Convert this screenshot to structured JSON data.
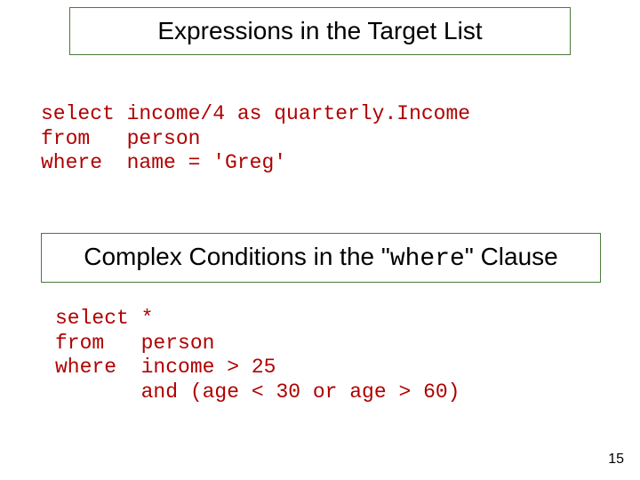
{
  "heading1": "Expressions in the Target List",
  "heading2_pre": "Complex Conditions in the \"",
  "heading2_mono": "where",
  "heading2_post": "\" Clause",
  "code1": "select income/4 as quarterly.Income\nfrom   person\nwhere  name = 'Greg'",
  "code2": "select *\nfrom   person\nwhere  income > 25\n       and (age < 30 or age > 60)",
  "page_number": "15"
}
